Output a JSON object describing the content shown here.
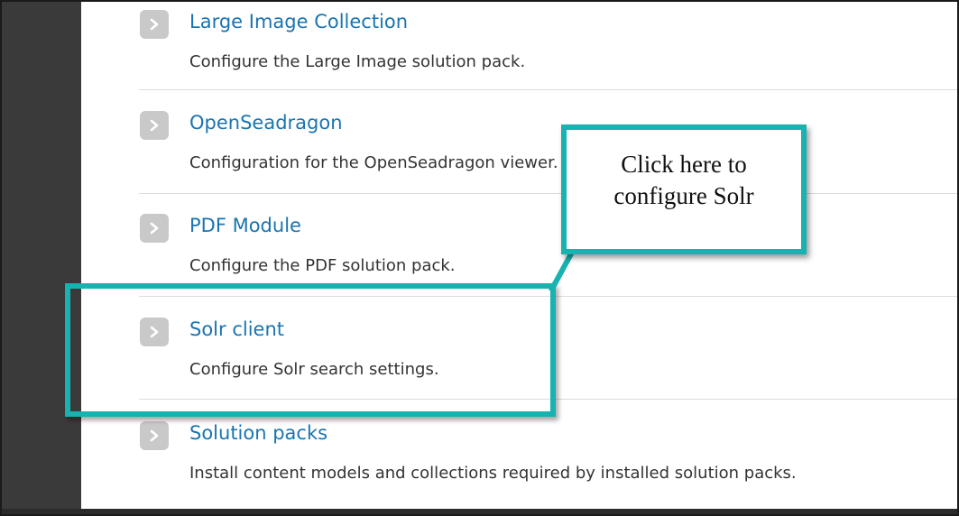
{
  "items": [
    {
      "title": "Large Image Collection",
      "description": "Configure the Large Image solution pack."
    },
    {
      "title": "OpenSeadragon",
      "description": "Configuration for the OpenSeadragon viewer."
    },
    {
      "title": "PDF Module",
      "description": "Configure the PDF solution pack."
    },
    {
      "title": "Solr client",
      "description": "Configure Solr search settings."
    },
    {
      "title": "Solution packs",
      "description": "Install content models and collections required by installed solution packs."
    }
  ],
  "callout": {
    "text": "Click here to\nconfigure Solr"
  },
  "colors": {
    "link": "#1a74b0",
    "accent": "#18b2b0",
    "chevron_bg": "#c9c9c9",
    "rail": "#3a3a3a"
  },
  "icons": {
    "item_expand": "chevron-right-icon"
  }
}
